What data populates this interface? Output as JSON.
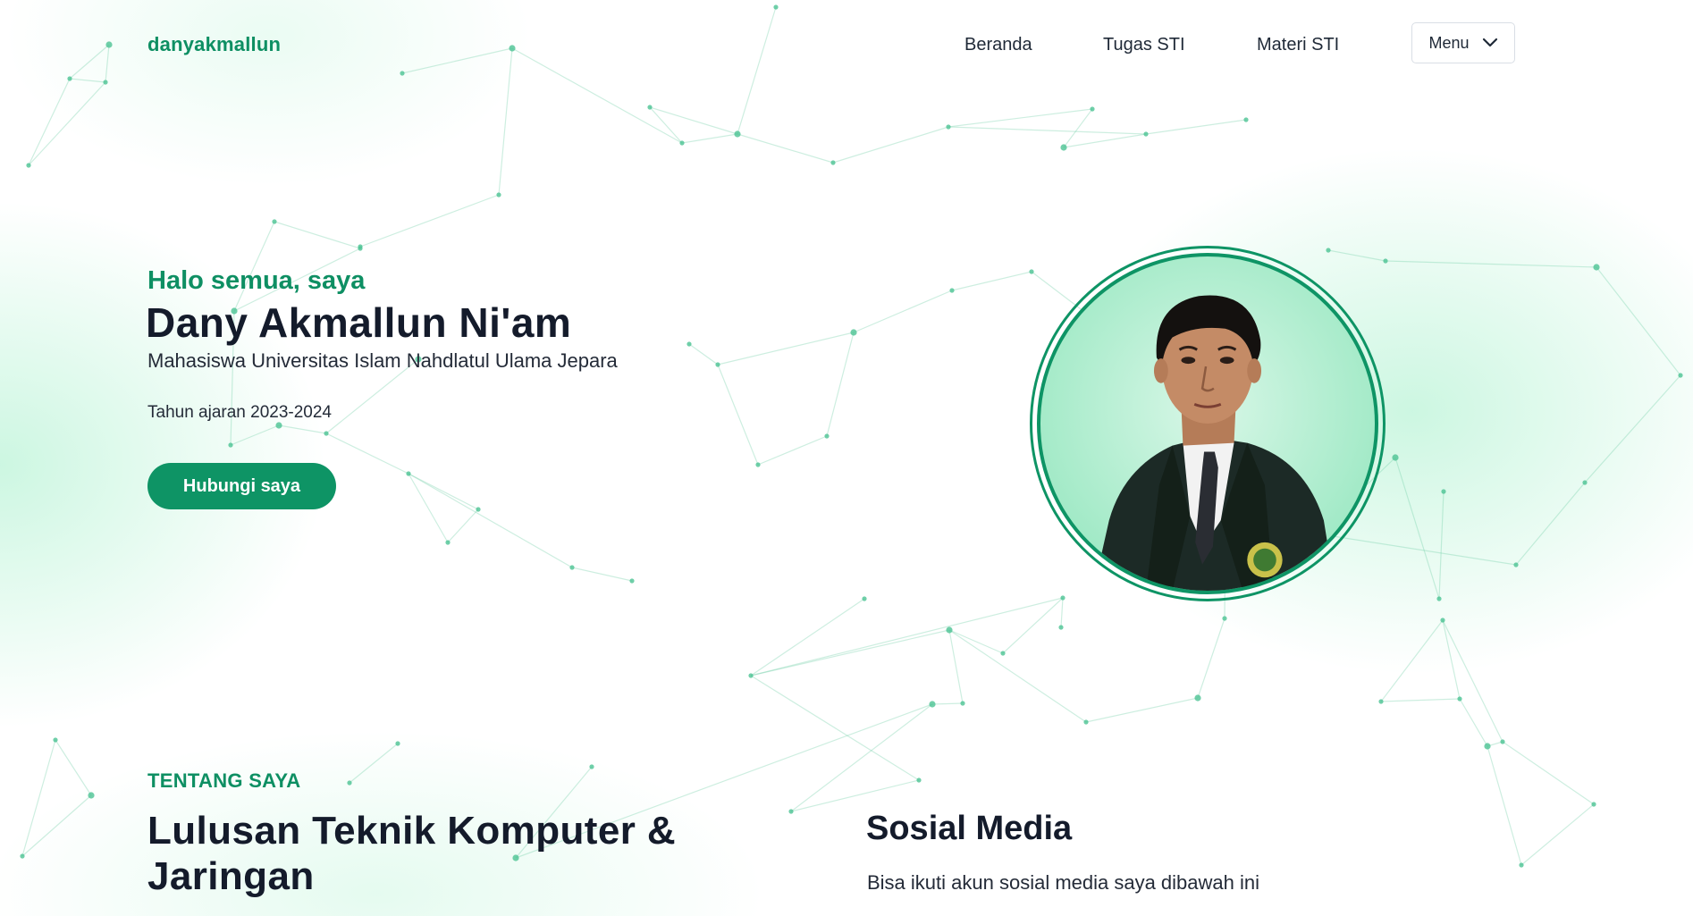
{
  "header": {
    "brand": "danyakmallun",
    "nav": {
      "beranda": "Beranda",
      "tugas": "Tugas STI",
      "materi": "Materi STI"
    },
    "menu_button": "Menu",
    "menu_icon": "chevron-down-icon"
  },
  "hero": {
    "greeting": "Halo semua, saya",
    "name": "Dany Akmallun Ni'am",
    "subtitle": "Mahasiswa Universitas Islam Nahdlatul Ulama Jepara",
    "year": "Tahun ajaran 2023-2024",
    "contact_button": "Hubungi saya",
    "portrait_alt": "profile-photo"
  },
  "about": {
    "label": "TENTANG SAYA",
    "title": "Lulusan Teknik Komputer & Jaringan"
  },
  "social": {
    "title": "Sosial Media",
    "description": "Bisa ikuti akun sosial media saya dibawah ini"
  },
  "theme": {
    "accent": "#0e9465",
    "accent_text": "#0e8f63",
    "heading": "#141b2b",
    "network_line": "#6fcfa5",
    "network_dot": "#4cc393"
  }
}
